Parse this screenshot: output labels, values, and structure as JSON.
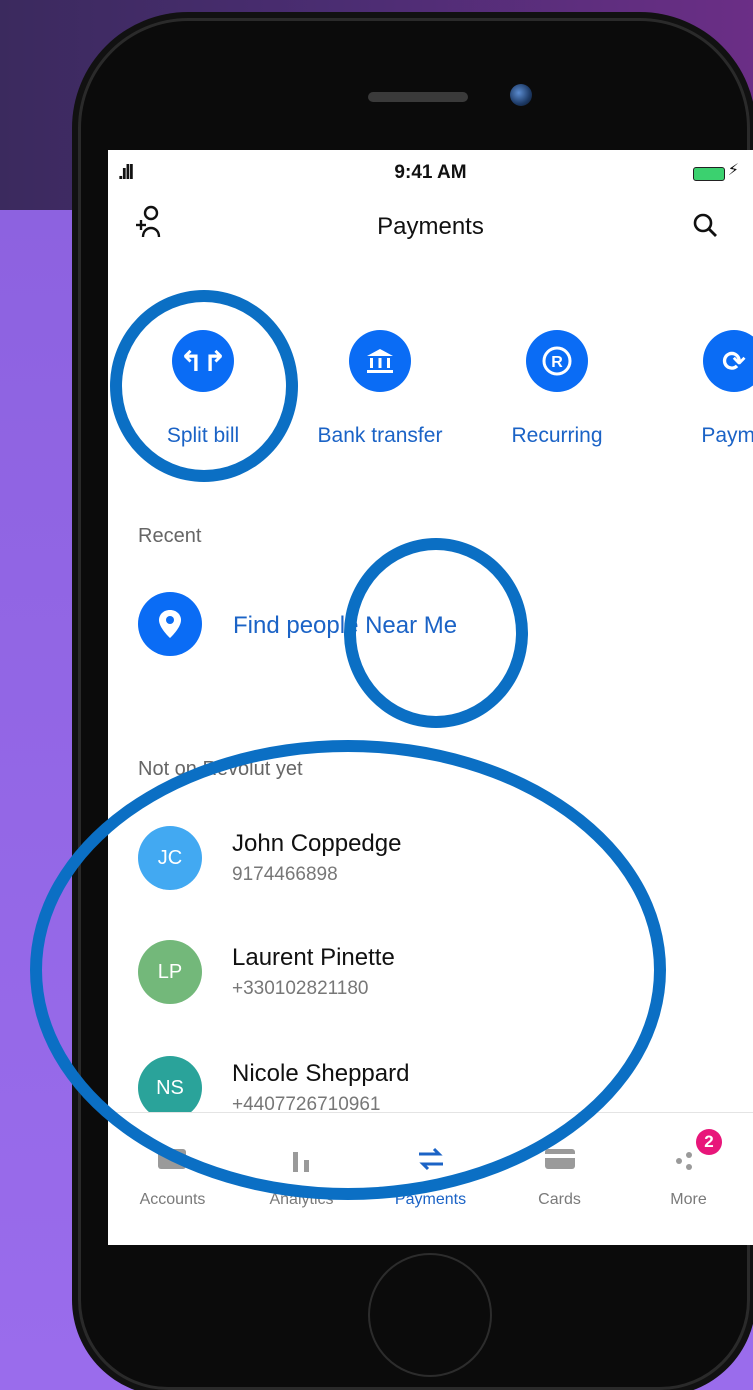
{
  "status_bar": {
    "time": "9:41 AM"
  },
  "header": {
    "title": "Payments",
    "left_icon": "add-contact-icon",
    "right_icon": "search-icon"
  },
  "actions": [
    {
      "label": "Split bill",
      "icon": "split-arrows-icon"
    },
    {
      "label": "Bank transfer",
      "icon": "bank-icon"
    },
    {
      "label": "Recurring",
      "icon": "recurring-icon"
    },
    {
      "label": "Payme",
      "icon": "payment-request-icon"
    }
  ],
  "sections": {
    "recent": "Recent",
    "near_me": "Find people Near Me",
    "not_on_revolut": "Not on Revolut yet"
  },
  "contacts": [
    {
      "initials": "JC",
      "name": "John Coppedge",
      "phone": "9174466898",
      "color": "#42a9f2"
    },
    {
      "initials": "LP",
      "name": "Laurent Pinette",
      "phone": "+330102821180",
      "color": "#73b87a"
    },
    {
      "initials": "NS",
      "name": "Nicole Sheppard",
      "phone": "+4407726710961",
      "color": "#2aa39a"
    }
  ],
  "tabs": [
    {
      "label": "Accounts",
      "icon": "wallet-icon",
      "active": false
    },
    {
      "label": "Analytics",
      "icon": "bar-chart-icon",
      "active": false
    },
    {
      "label": "Payments",
      "icon": "transfer-arrows-icon",
      "active": true
    },
    {
      "label": "Cards",
      "icon": "card-icon",
      "active": false
    },
    {
      "label": "More",
      "icon": "dots-icon",
      "active": false,
      "badge": "2"
    }
  ],
  "colors": {
    "accent": "#0a6cf5",
    "annotation": "#0b6fc4"
  }
}
